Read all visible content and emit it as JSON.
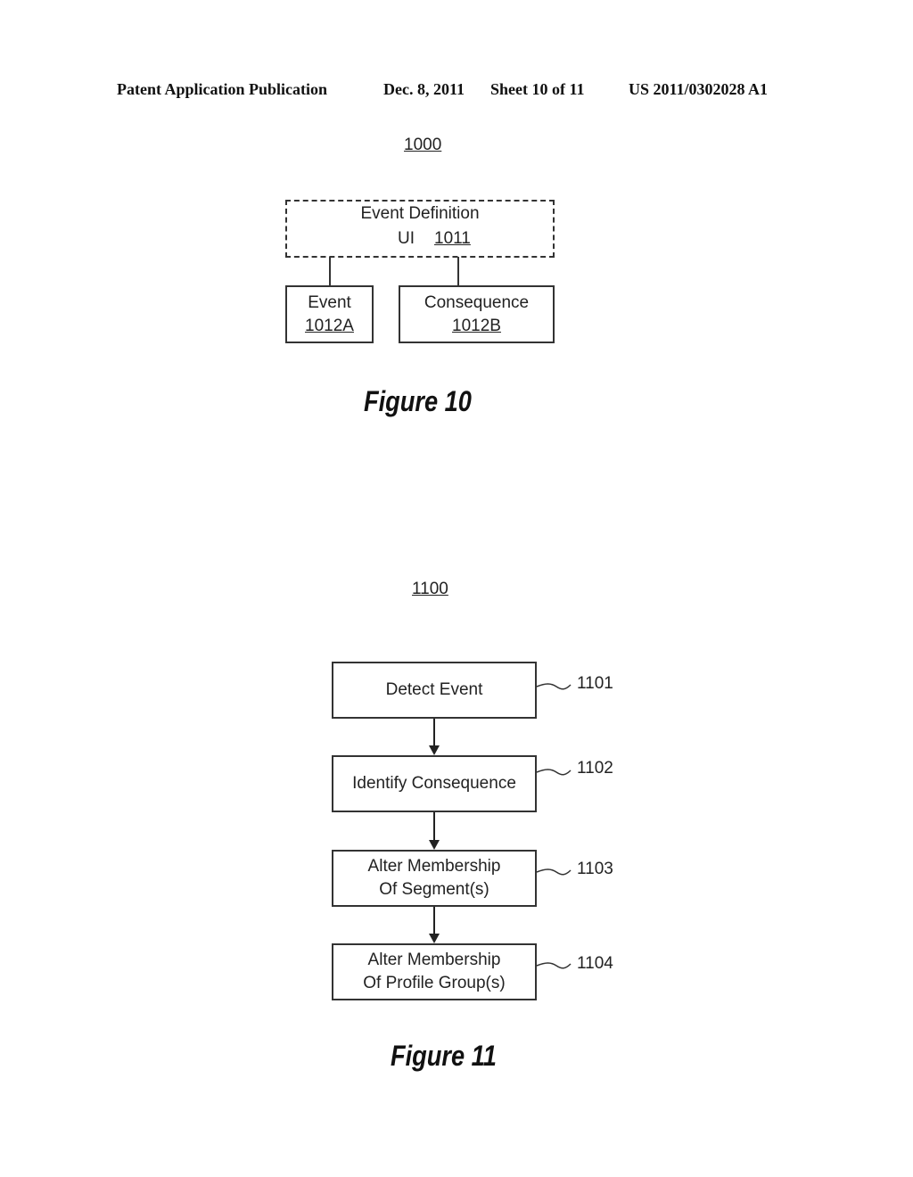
{
  "header": {
    "publication": "Patent Application Publication",
    "date": "Dec. 8, 2011",
    "sheet": "Sheet 10 of 11",
    "number": "US 2011/0302028 A1"
  },
  "figure10": {
    "ref": "1000",
    "ui_box": {
      "line1": "Event Definition",
      "line2_prefix": "UI",
      "line2_ref": "1011"
    },
    "event_box": {
      "label": "Event",
      "ref": "1012A"
    },
    "consequence_box": {
      "label": "Consequence",
      "ref": "1012B"
    },
    "caption": "Figure 10"
  },
  "figure11": {
    "ref": "1100",
    "steps": [
      {
        "line1": "Detect Event",
        "line2": "",
        "ref": "1101"
      },
      {
        "line1": "Identify Consequence",
        "line2": "",
        "ref": "1102"
      },
      {
        "line1": "Alter Membership",
        "line2": "Of Segment(s)",
        "ref": "1103"
      },
      {
        "line1": "Alter Membership",
        "line2": "Of Profile Group(s)",
        "ref": "1104"
      }
    ],
    "caption": "Figure 11"
  }
}
